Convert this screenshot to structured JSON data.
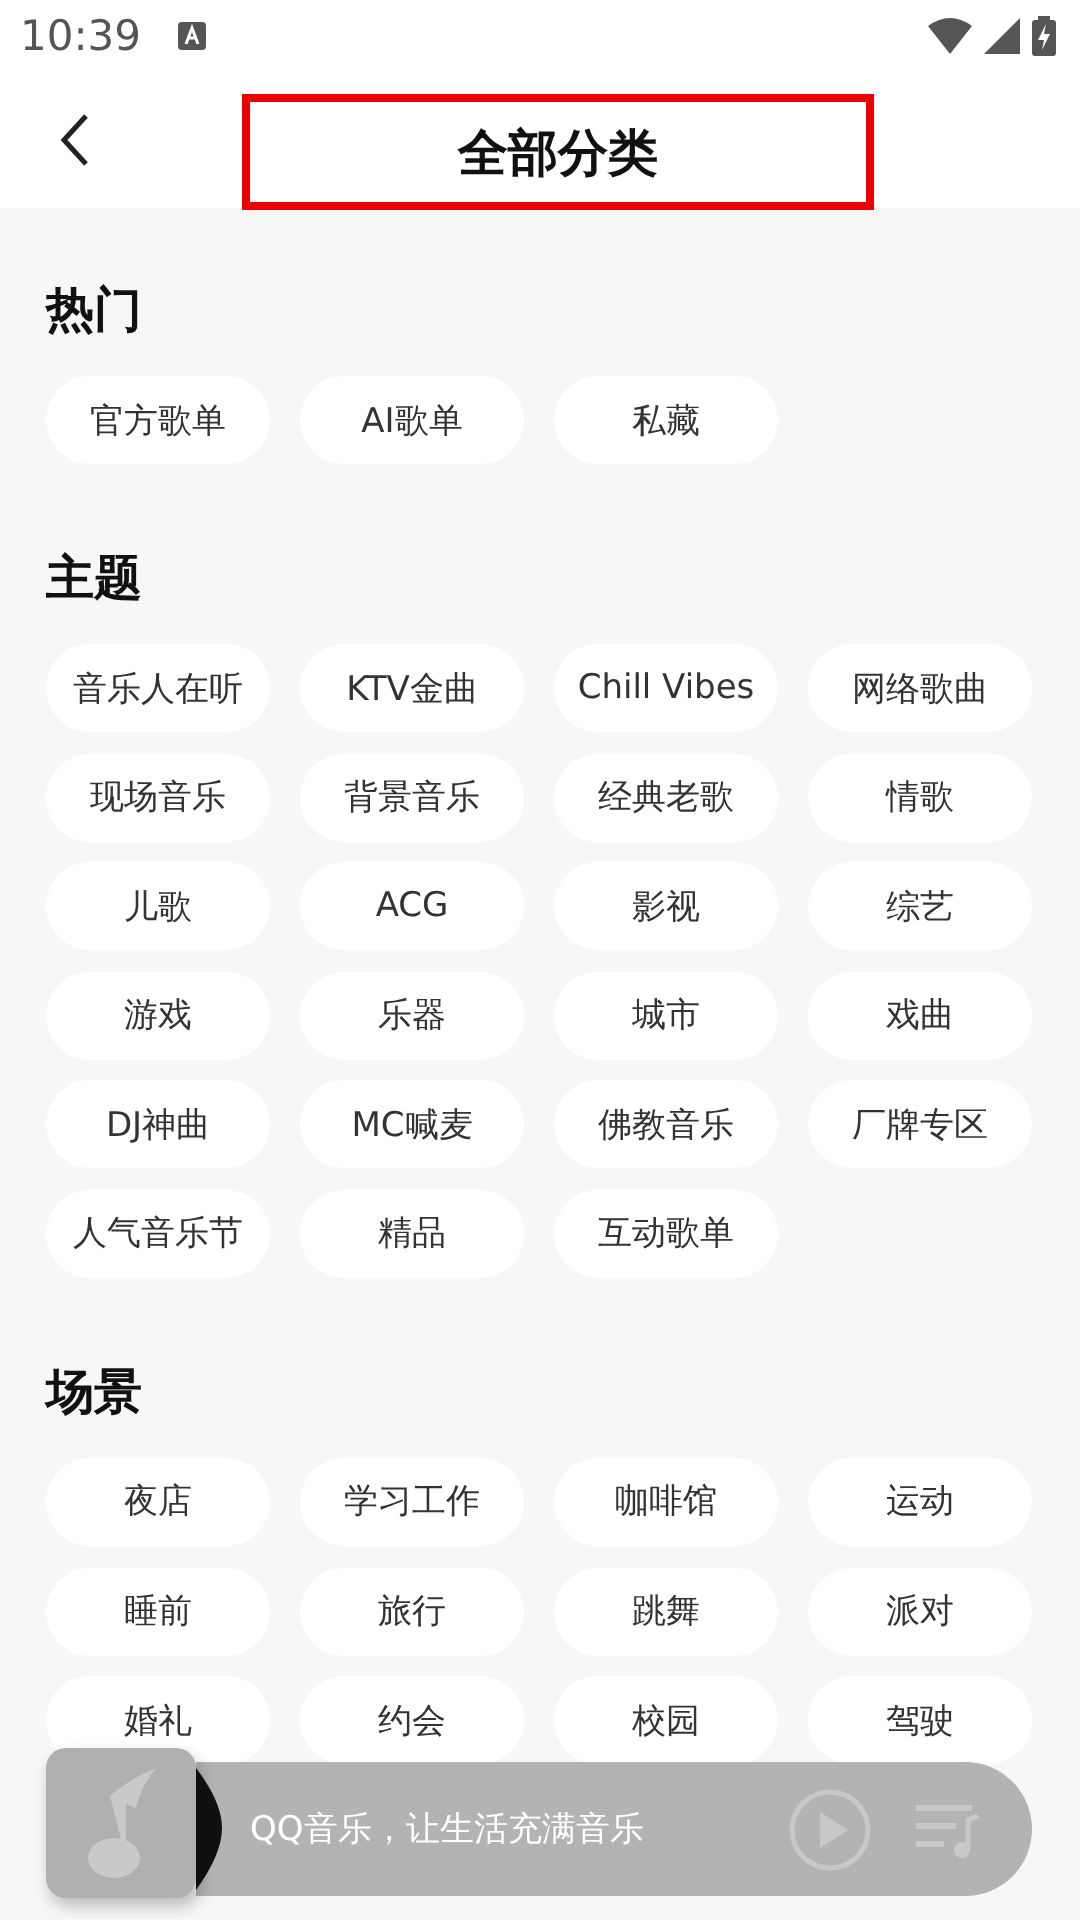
{
  "status_bar": {
    "time": "10:39"
  },
  "header": {
    "title": "全部分类"
  },
  "sections": [
    {
      "title": "热门",
      "tags": [
        "官方歌单",
        "AI歌单",
        "私藏"
      ]
    },
    {
      "title": "主题",
      "tags": [
        "音乐人在听",
        "KTV金曲",
        "Chill Vibes",
        "网络歌曲",
        "现场音乐",
        "背景音乐",
        "经典老歌",
        "情歌",
        "儿歌",
        "ACG",
        "影视",
        "综艺",
        "游戏",
        "乐器",
        "城市",
        "戏曲",
        "DJ神曲",
        "MC喊麦",
        "佛教音乐",
        "厂牌专区",
        "人气音乐节",
        "精品",
        "互动歌单"
      ]
    },
    {
      "title": "场景",
      "tags": [
        "夜店",
        "学习工作",
        "咖啡馆",
        "运动",
        "睡前",
        "旅行",
        "跳舞",
        "派对",
        "婚礼",
        "约会",
        "校园",
        "驾驶"
      ]
    }
  ],
  "player": {
    "text": "QQ音乐，让生活充满音乐"
  }
}
